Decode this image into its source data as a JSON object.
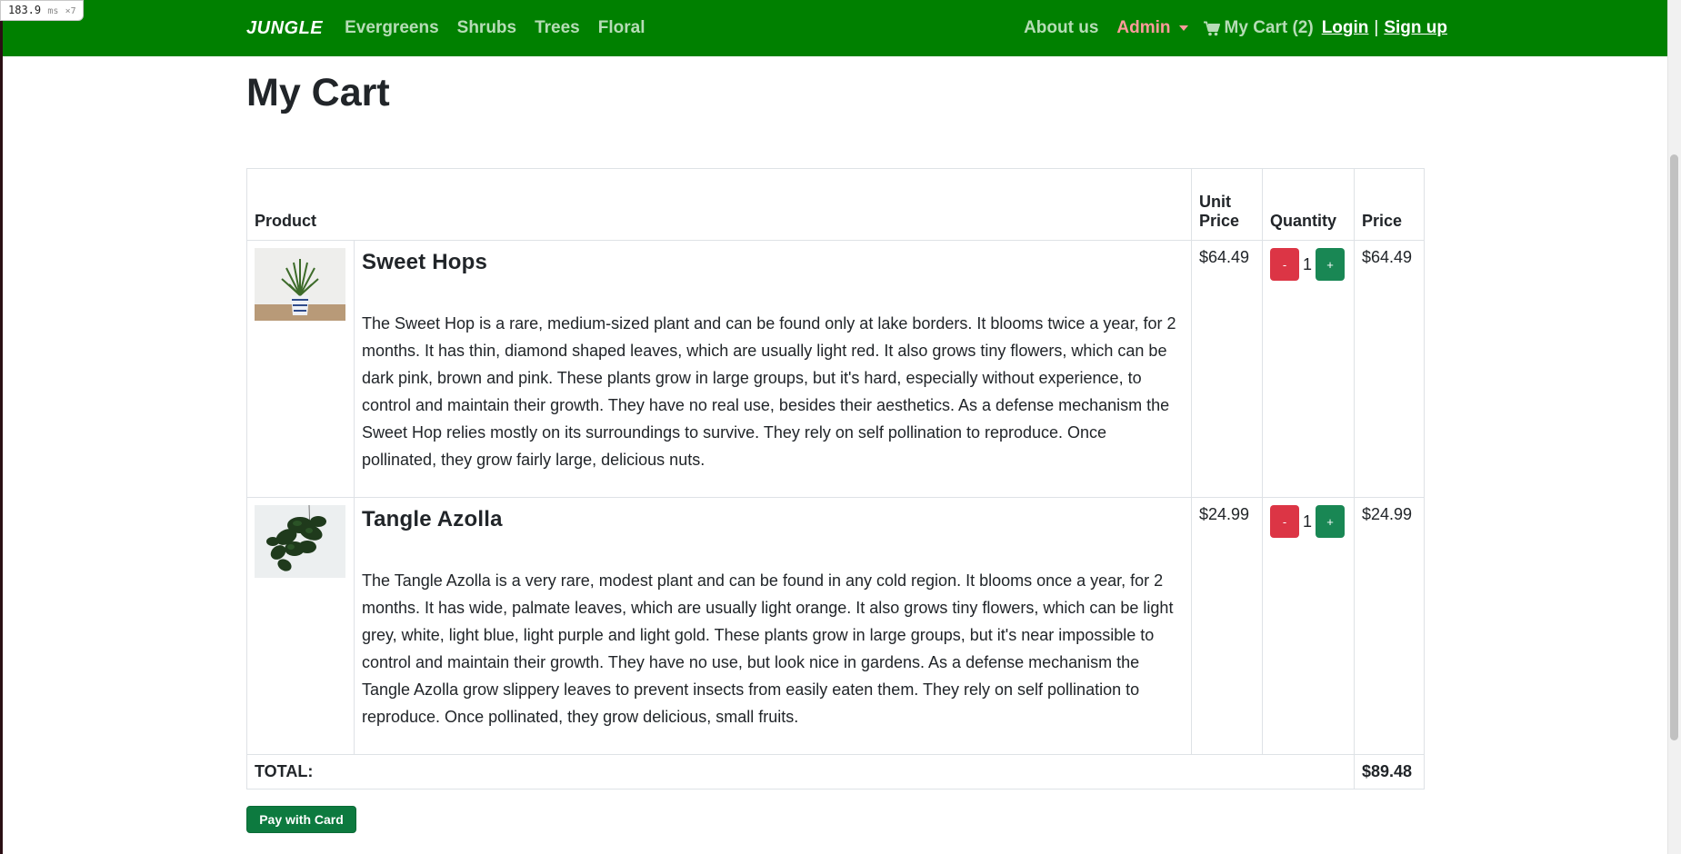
{
  "debug": {
    "timing_value": "183.9",
    "timing_unit": "ms",
    "timing_count": "×7"
  },
  "nav": {
    "brand": "JUNGLE",
    "categories": [
      "Evergreens",
      "Shrubs",
      "Trees",
      "Floral"
    ],
    "about": "About us",
    "admin": "Admin",
    "cart": "My Cart (2)",
    "login": "Login",
    "separator": "|",
    "signup": "Sign up"
  },
  "page": {
    "title": "My Cart"
  },
  "table": {
    "headers": {
      "product": "Product",
      "unit_price": "Unit Price",
      "quantity": "Quantity",
      "price": "Price"
    },
    "items": [
      {
        "name": "Sweet Hops",
        "description": "The Sweet Hop is a rare, medium-sized plant and can be found only at lake borders. It blooms twice a year, for 2 months. It has thin, diamond shaped leaves, which are usually light red. It also grows tiny flowers, which can be dark pink, brown and pink. These plants grow in large groups, but it's hard, especially without experience, to control and maintain their growth. They have no real use, besides their aesthetics. As a defense mechanism the Sweet Hop relies mostly on its surroundings to survive. They rely on self pollination to reproduce. Once pollinated, they grow fairly large, delicious nuts.",
        "unit_price": "$64.49",
        "quantity": "1",
        "price": "$64.49",
        "image": "potted-palm-plant"
      },
      {
        "name": "Tangle Azolla",
        "description": "The Tangle Azolla is a very rare, modest plant and can be found in any cold region. It blooms once a year, for 2 months. It has wide, palmate leaves, which are usually light orange. It also grows tiny flowers, which can be light grey, white, light blue, light purple and light gold. These plants grow in large groups, but it's near impossible to control and maintain their growth. They have no use, but look nice in gardens. As a defense mechanism the Tangle Azolla grow slippery leaves to prevent insects from easily eaten them. They rely on self pollination to reproduce. Once pollinated, they grow delicious, small fruits.",
        "unit_price": "$24.99",
        "quantity": "1",
        "price": "$24.99",
        "image": "hanging-pothos-plant"
      }
    ],
    "decrement_label": "-",
    "increment_label": "+",
    "total_label": "TOTAL:",
    "total_value": "$89.48"
  },
  "actions": {
    "pay_label": "Pay with Card"
  },
  "colors": {
    "navbar": "#008000",
    "admin": "#ff9b9b",
    "minus": "#dc3545",
    "plus": "#198754",
    "pay": "#0d7a3f"
  }
}
